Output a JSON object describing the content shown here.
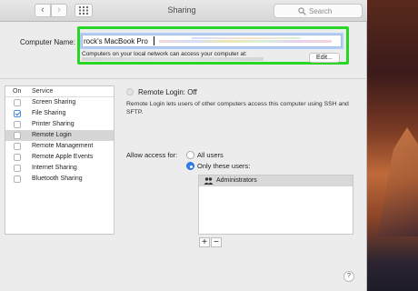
{
  "toolbar": {
    "title": "Sharing",
    "back_glyph": "‹",
    "forward_glyph": "›",
    "search_placeholder": "Search",
    "icons": [
      "chevron-left-icon",
      "chevron-right-icon",
      "grid-icon",
      "search-icon"
    ]
  },
  "computer_name": {
    "label": "Computer Name:",
    "value": "rock's MacBook Pro",
    "description": "Computers on your local network can access your computer at:",
    "edit_label": "Edit...",
    "highlight_color": "#29d626"
  },
  "service_list": {
    "header_on": "On",
    "header_service": "Service",
    "items": [
      {
        "label": "Screen Sharing",
        "on": false
      },
      {
        "label": "File Sharing",
        "on": true
      },
      {
        "label": "Printer Sharing",
        "on": false
      },
      {
        "label": "Remote Login",
        "on": false,
        "selected": true
      },
      {
        "label": "Remote Management",
        "on": false
      },
      {
        "label": "Remote Apple Events",
        "on": false
      },
      {
        "label": "Internet Sharing",
        "on": false
      },
      {
        "label": "Bluetooth Sharing",
        "on": false
      }
    ]
  },
  "detail": {
    "status": "Remote Login: Off",
    "description": "Remote Login lets users of other computers access this computer using SSH and SFTP.",
    "allow_label": "Allow access for:",
    "option_all": "All users",
    "option_only": "Only these users:",
    "selected_option": "Only these users:",
    "users": [
      "Administrators"
    ],
    "add_label": "+",
    "remove_label": "−",
    "help_label": "?"
  },
  "colors": {
    "accent": "#2f7ff0",
    "highlight": "#29d626"
  }
}
